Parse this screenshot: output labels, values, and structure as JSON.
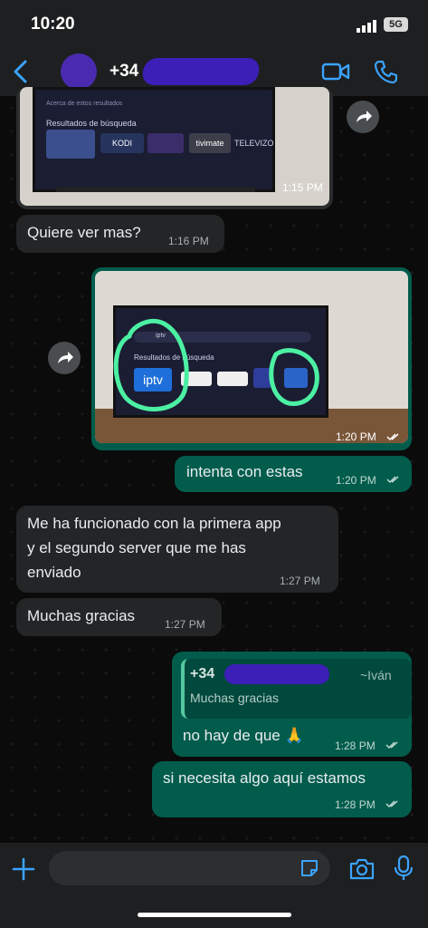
{
  "status": {
    "time": "10:20",
    "network": "5G"
  },
  "header": {
    "contact_number": "+34",
    "video_icon": "video-call-icon",
    "call_icon": "phone-icon"
  },
  "messages": {
    "m1": {
      "time": "1:15 PM",
      "tv_search_label": "Resultados de búsqueda",
      "tv_hint": "Acerca de estos resultados",
      "apps": [
        "KODI",
        "tivimate",
        "TELEVIZO"
      ]
    },
    "m2": {
      "text": "Quiere ver mas?",
      "time": "1:16 PM"
    },
    "m3": {
      "time": "1:20 PM",
      "tv_search_label": "Resultados de búsqueda",
      "tv_query": "iptv",
      "app": "iptv"
    },
    "m4": {
      "text": "intenta con estas",
      "time": "1:20 PM"
    },
    "m5": {
      "line1": "Me ha funcionado con la primera app",
      "line2": "y el segundo server que me has",
      "line3": "enviado",
      "time": "1:27 PM"
    },
    "m6": {
      "text": "Muchas gracias",
      "time": "1:27 PM"
    },
    "m7": {
      "quote_author": "+34",
      "quote_name": "~Iván",
      "quote_text": "Muchas gracias",
      "text": "no hay de que 🙏",
      "time": "1:28 PM"
    },
    "m8": {
      "text": "si necesita algo aquí estamos",
      "time": "1:28 PM"
    }
  },
  "colors": {
    "accent": "#3ba3ff",
    "outgoing": "#025c4c",
    "incoming": "#232526",
    "highlight": "#4cf0a3"
  }
}
